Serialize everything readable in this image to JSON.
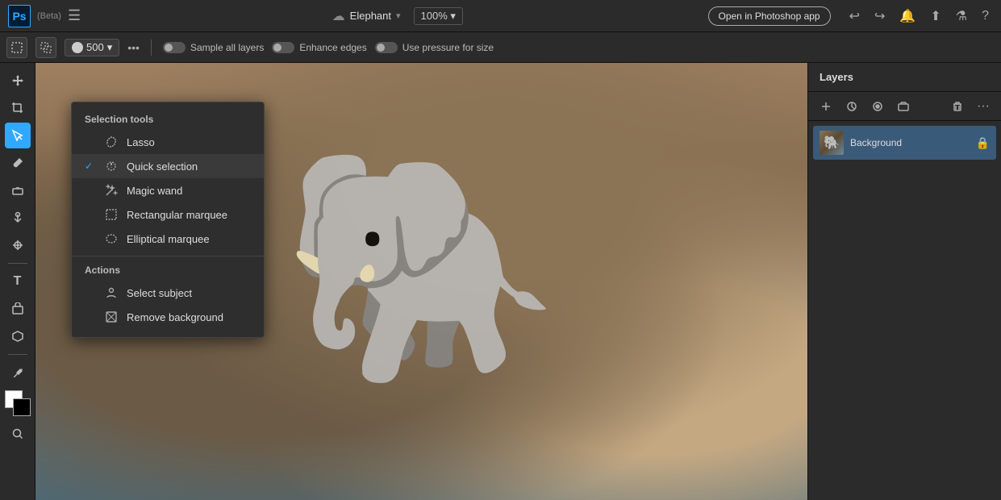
{
  "topbar": {
    "logo": "Ps",
    "beta": "(Beta)",
    "doc_name": "Elephant",
    "zoom": "100%",
    "open_ps_btn": "Open in Photoshop app",
    "chevron": "▾",
    "hamburger": "☰"
  },
  "optionsbar": {
    "brush_size": "500",
    "more_label": "•••",
    "sample_all_layers": "Sample all layers",
    "enhance_edges": "Enhance edges",
    "use_pressure": "Use pressure for size"
  },
  "selection_dropdown": {
    "section_selection_tools": "Selection tools",
    "lasso": "Lasso",
    "quick_selection": "Quick selection",
    "magic_wand": "Magic wand",
    "rectangular_marquee": "Rectangular marquee",
    "elliptical_marquee": "Elliptical marquee",
    "section_actions": "Actions",
    "select_subject": "Select subject",
    "remove_background": "Remove background"
  },
  "layers_panel": {
    "title": "Layers",
    "layer_name": "Background"
  },
  "colors": {
    "accent": "#31a8ff",
    "active_tool_bg": "#31a8ff",
    "panel_bg": "#2b2b2b",
    "dropdown_bg": "#2e2e2e"
  }
}
